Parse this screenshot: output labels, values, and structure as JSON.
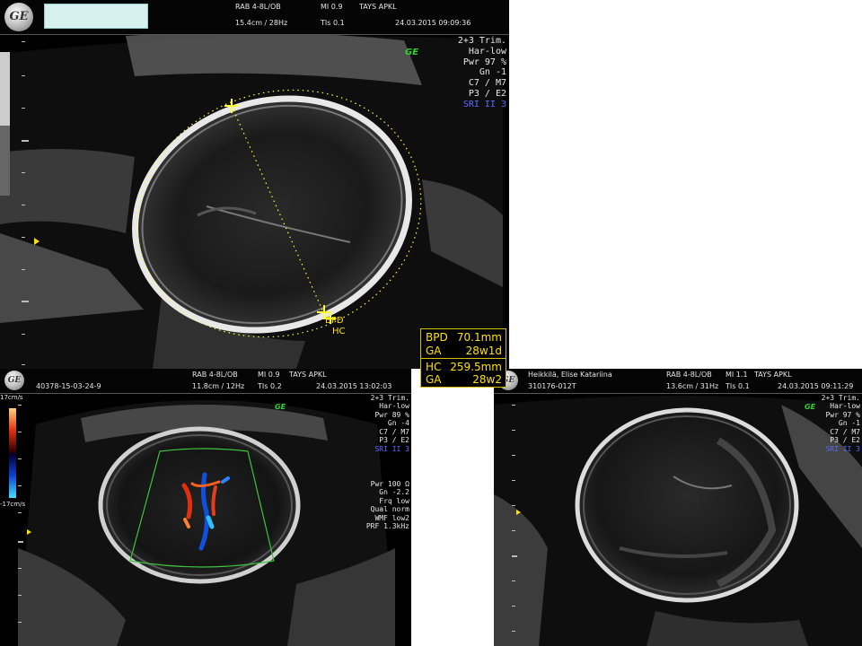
{
  "panel1": {
    "header": {
      "probe": "RAB 4-8L/OB",
      "mi": "MI  0.9",
      "site": "TAYS APKL",
      "depth": "15.4cm / 28Hz",
      "tis": "TIs  0.1",
      "datetime": "24.03.2015  09:09:36"
    },
    "params": [
      "2+3 Trim.",
      "Har-low",
      "Pwr  97 %",
      "Gn  -1",
      "C7 / M7",
      "P3 / E2"
    ],
    "params_blue": "SRI II 3",
    "badge": "GE",
    "caliper_labels": {
      "bpd": "BPD",
      "hc": "HC"
    },
    "measurements": {
      "bpd_label": "BPD",
      "bpd_value": "70.1mm",
      "ga1_label": "GA",
      "ga1_value": "28w1d",
      "hc_label": "HC",
      "hc_value": "259.5mm",
      "ga2_label": "GA",
      "ga2_value": "28w2"
    }
  },
  "panel2": {
    "header": {
      "patient_id": "40378-15-03-24-9",
      "probe": "RAB 4-8L/OB",
      "mi": "MI  0.9",
      "site": "TAYS APKL",
      "depth": "11.8cm / 12Hz",
      "tis": "TIs  0.2",
      "datetime": "24.03.2015  13:02:03"
    },
    "color_scale_top": "17cm/s",
    "color_scale_bottom": "-17cm/s",
    "params": [
      "2+3 Trim.",
      "Har-low",
      "Pwr  89 %",
      "Gn  -4",
      "C7 / M7",
      "P3 / E2"
    ],
    "params_blue": "SRI II 3",
    "doppler_params": [
      "Pwr 100 Ω",
      "Gn  -2.2",
      "Frq low",
      "Qual norm",
      "WMF low2",
      "PRF  1.3kHz"
    ],
    "badge": "GE"
  },
  "panel3": {
    "header": {
      "patient_name": "Heikkilä, Elise Katariina",
      "patient_id": "310176-012T",
      "probe": "RAB 4-8L/OB",
      "mi": "MI  1.1",
      "site": "TAYS APKL",
      "depth": "13.6cm / 31Hz",
      "tis": "TIs  0.1",
      "datetime": "24.03.2015  09:11:29"
    },
    "params": [
      "2+3 Trim.",
      "Har-low",
      "Pwr  97 %",
      "Gn  -1",
      "C7 / M7",
      "P3 / E2"
    ],
    "params_blue": "SRI II 3",
    "badge": "GE"
  },
  "colors": {
    "measurement_yellow": "#ffe100",
    "caliper_yellow": "#ffff33",
    "badge_green": "#2fd02f",
    "sri_blue": "#5c6cff",
    "roi_green": "#3ec43e"
  }
}
